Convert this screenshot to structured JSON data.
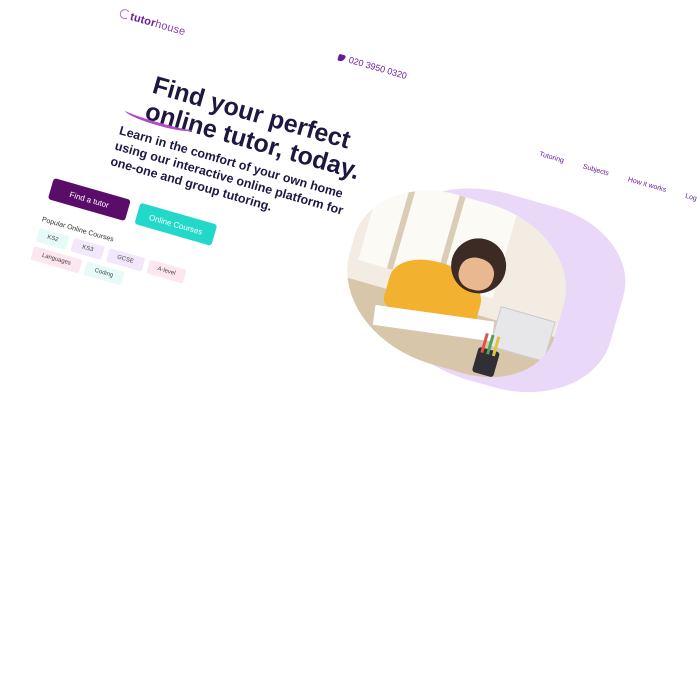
{
  "brand": {
    "logo_bold": "tutor",
    "logo_thin": "house"
  },
  "contact": {
    "phone": "020 3950 0320"
  },
  "nav": {
    "items": [
      "Tutoring",
      "Subjects",
      "How it works",
      "Log in"
    ]
  },
  "hero": {
    "headline": "Find your perfect online tutor, today.",
    "subheadline": "Learn in the comfort of your own home using our interactive online platform for one-one and group tutoring.",
    "primary_cta": "Find a tutor",
    "secondary_cta": "Online Courses"
  },
  "courses": {
    "title": "Popular Online Courses",
    "chips": [
      "KS2",
      "KS3",
      "GCSE",
      "A-level",
      "Languages",
      "Coding"
    ]
  },
  "colors": {
    "brand_purple": "#5a0d68",
    "accent_teal": "#22d8c8",
    "heading": "#1f1742",
    "blob": "#ead8f8"
  },
  "icons": {
    "phone": "phone-icon",
    "logo": "logo-mark-icon"
  }
}
